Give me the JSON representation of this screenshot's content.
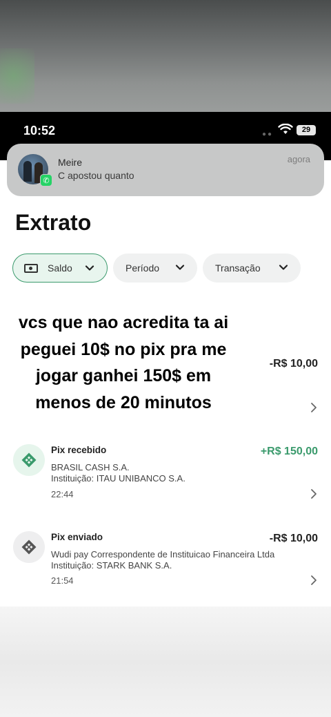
{
  "status_bar": {
    "time": "10:52",
    "battery": "29"
  },
  "notification": {
    "sender": "Meire",
    "message": "C apostou quanto",
    "time": "agora",
    "app_icon": "whatsapp-icon"
  },
  "header": {
    "title": "Extrato"
  },
  "filters": [
    {
      "label": "Saldo",
      "icon": "money-icon",
      "active": true
    },
    {
      "label": "Período",
      "active": false
    },
    {
      "label": "Transação",
      "active": false
    }
  ],
  "overlay_caption": "vcs que nao acredita ta ai peguei 10$ no pix pra me jogar ganhei 150$ em menos de 20 minutos",
  "transactions": [
    {
      "amount": "-R$ 10,00"
    },
    {
      "type": "Pix recebido",
      "amount": "+R$ 150,00",
      "name": "BRASIL CASH S.A.",
      "institution": "Instituição: ITAU UNIBANCO S.A.",
      "time": "22:44"
    },
    {
      "type": "Pix enviado",
      "amount": "-R$ 10,00",
      "name": "Wudi pay Correspondente de Instituicao Financeira Ltda",
      "institution": "Instituição: STARK BANK S.A.",
      "time": "21:54"
    }
  ],
  "colors": {
    "accent": "#3a9a6c",
    "positive": "#3a9a6c",
    "chip_bg": "#f0f1f1"
  }
}
